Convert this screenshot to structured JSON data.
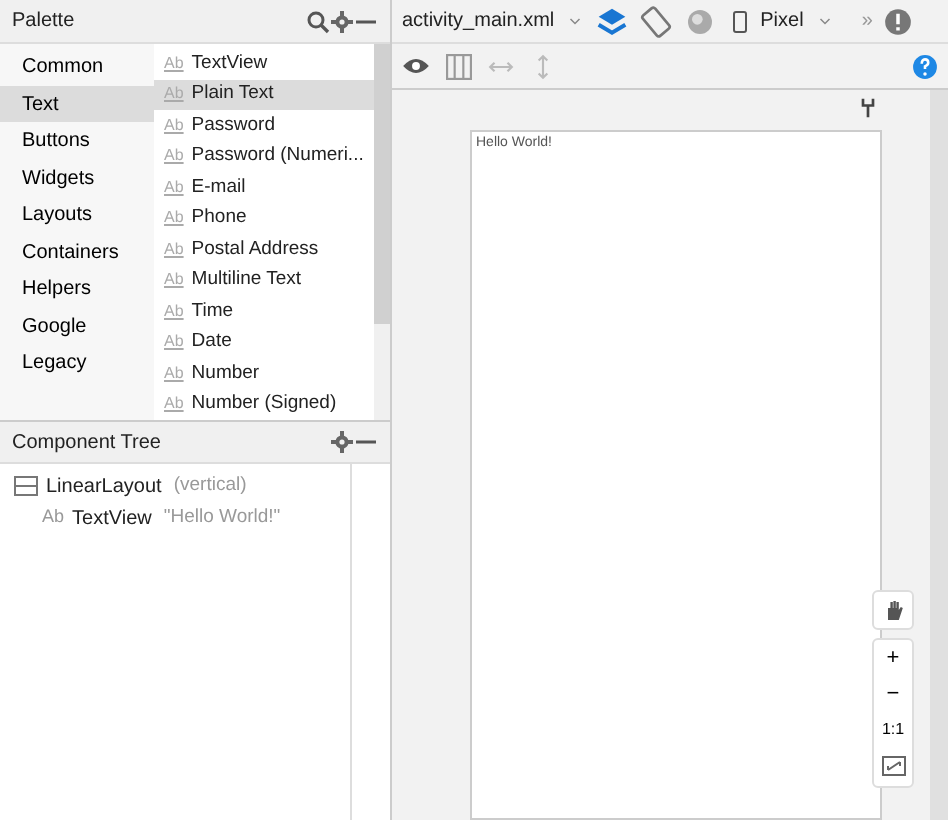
{
  "palette": {
    "title": "Palette",
    "categories": [
      {
        "label": "Common",
        "selected": false
      },
      {
        "label": "Text",
        "selected": true
      },
      {
        "label": "Buttons",
        "selected": false
      },
      {
        "label": "Widgets",
        "selected": false
      },
      {
        "label": "Layouts",
        "selected": false
      },
      {
        "label": "Containers",
        "selected": false
      },
      {
        "label": "Helpers",
        "selected": false
      },
      {
        "label": "Google",
        "selected": false
      },
      {
        "label": "Legacy",
        "selected": false
      }
    ],
    "items": [
      {
        "icon": "Ab",
        "label": "TextView",
        "selected": false
      },
      {
        "icon": "Ab",
        "label": "Plain Text",
        "selected": true
      },
      {
        "icon": "Ab",
        "label": "Password",
        "selected": false
      },
      {
        "icon": "Ab",
        "label": "Password (Numeri...",
        "selected": false
      },
      {
        "icon": "Ab",
        "label": "E-mail",
        "selected": false
      },
      {
        "icon": "Ab",
        "label": "Phone",
        "selected": false
      },
      {
        "icon": "Ab",
        "label": "Postal Address",
        "selected": false
      },
      {
        "icon": "Ab",
        "label": "Multiline Text",
        "selected": false
      },
      {
        "icon": "Ab",
        "label": "Time",
        "selected": false
      },
      {
        "icon": "Ab",
        "label": "Date",
        "selected": false
      },
      {
        "icon": "Ab",
        "label": "Number",
        "selected": false
      },
      {
        "icon": "Ab",
        "label": "Number (Signed)",
        "selected": false
      }
    ]
  },
  "component_tree": {
    "title": "Component Tree",
    "nodes": [
      {
        "kind": "layout",
        "label": "LinearLayout",
        "detail": "(vertical)",
        "children": [
          {
            "kind": "text",
            "icon": "Ab",
            "label": "TextView",
            "detail": "\"Hello World!\""
          }
        ]
      }
    ]
  },
  "toolbar": {
    "file": "activity_main.xml",
    "device": "Pixel",
    "more": "»"
  },
  "zoom_controls": {
    "plus": "+",
    "minus": "−",
    "actual": "1:1"
  },
  "preview": {
    "text": "Hello World!"
  }
}
